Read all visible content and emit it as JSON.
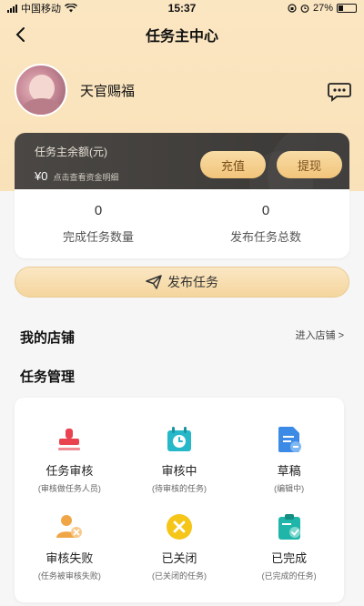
{
  "status": {
    "carrier": "中国移动",
    "time": "15:37",
    "battery": "27%"
  },
  "nav": {
    "title": "任务主中心"
  },
  "profile": {
    "username": "天官赐福"
  },
  "balance": {
    "label": "任务主余额(元)",
    "amount": "¥0",
    "hint": "点击查看资金明细",
    "recharge_label": "充值",
    "withdraw_label": "提现"
  },
  "stats": [
    {
      "value": "0",
      "label": "完成任务数量"
    },
    {
      "value": "0",
      "label": "发布任务总数"
    }
  ],
  "publish": {
    "label": "发布任务"
  },
  "shop": {
    "title": "我的店铺",
    "enter_label": "进入店铺 >"
  },
  "task_mgmt": {
    "title": "任务管理",
    "items": [
      {
        "name": "任务审核",
        "sub": "(审核做任务人员)",
        "icon": "stamp-icon",
        "color": "#e8434f"
      },
      {
        "name": "审核中",
        "sub": "(待审核的任务)",
        "icon": "calendar-clock-icon",
        "color": "#26b8c9"
      },
      {
        "name": "草稿",
        "sub": "(编辑中)",
        "icon": "document-icon",
        "color": "#3b8ae6"
      },
      {
        "name": "审核失败",
        "sub": "(任务被审核失败)",
        "icon": "user-fail-icon",
        "color": "#f0a646"
      },
      {
        "name": "已关闭",
        "sub": "(已关闭的任务)",
        "icon": "close-circle-icon",
        "color": "#f5c518"
      },
      {
        "name": "已完成",
        "sub": "(已完成的任务)",
        "icon": "clipboard-check-icon",
        "color": "#1fb5a8"
      }
    ]
  }
}
